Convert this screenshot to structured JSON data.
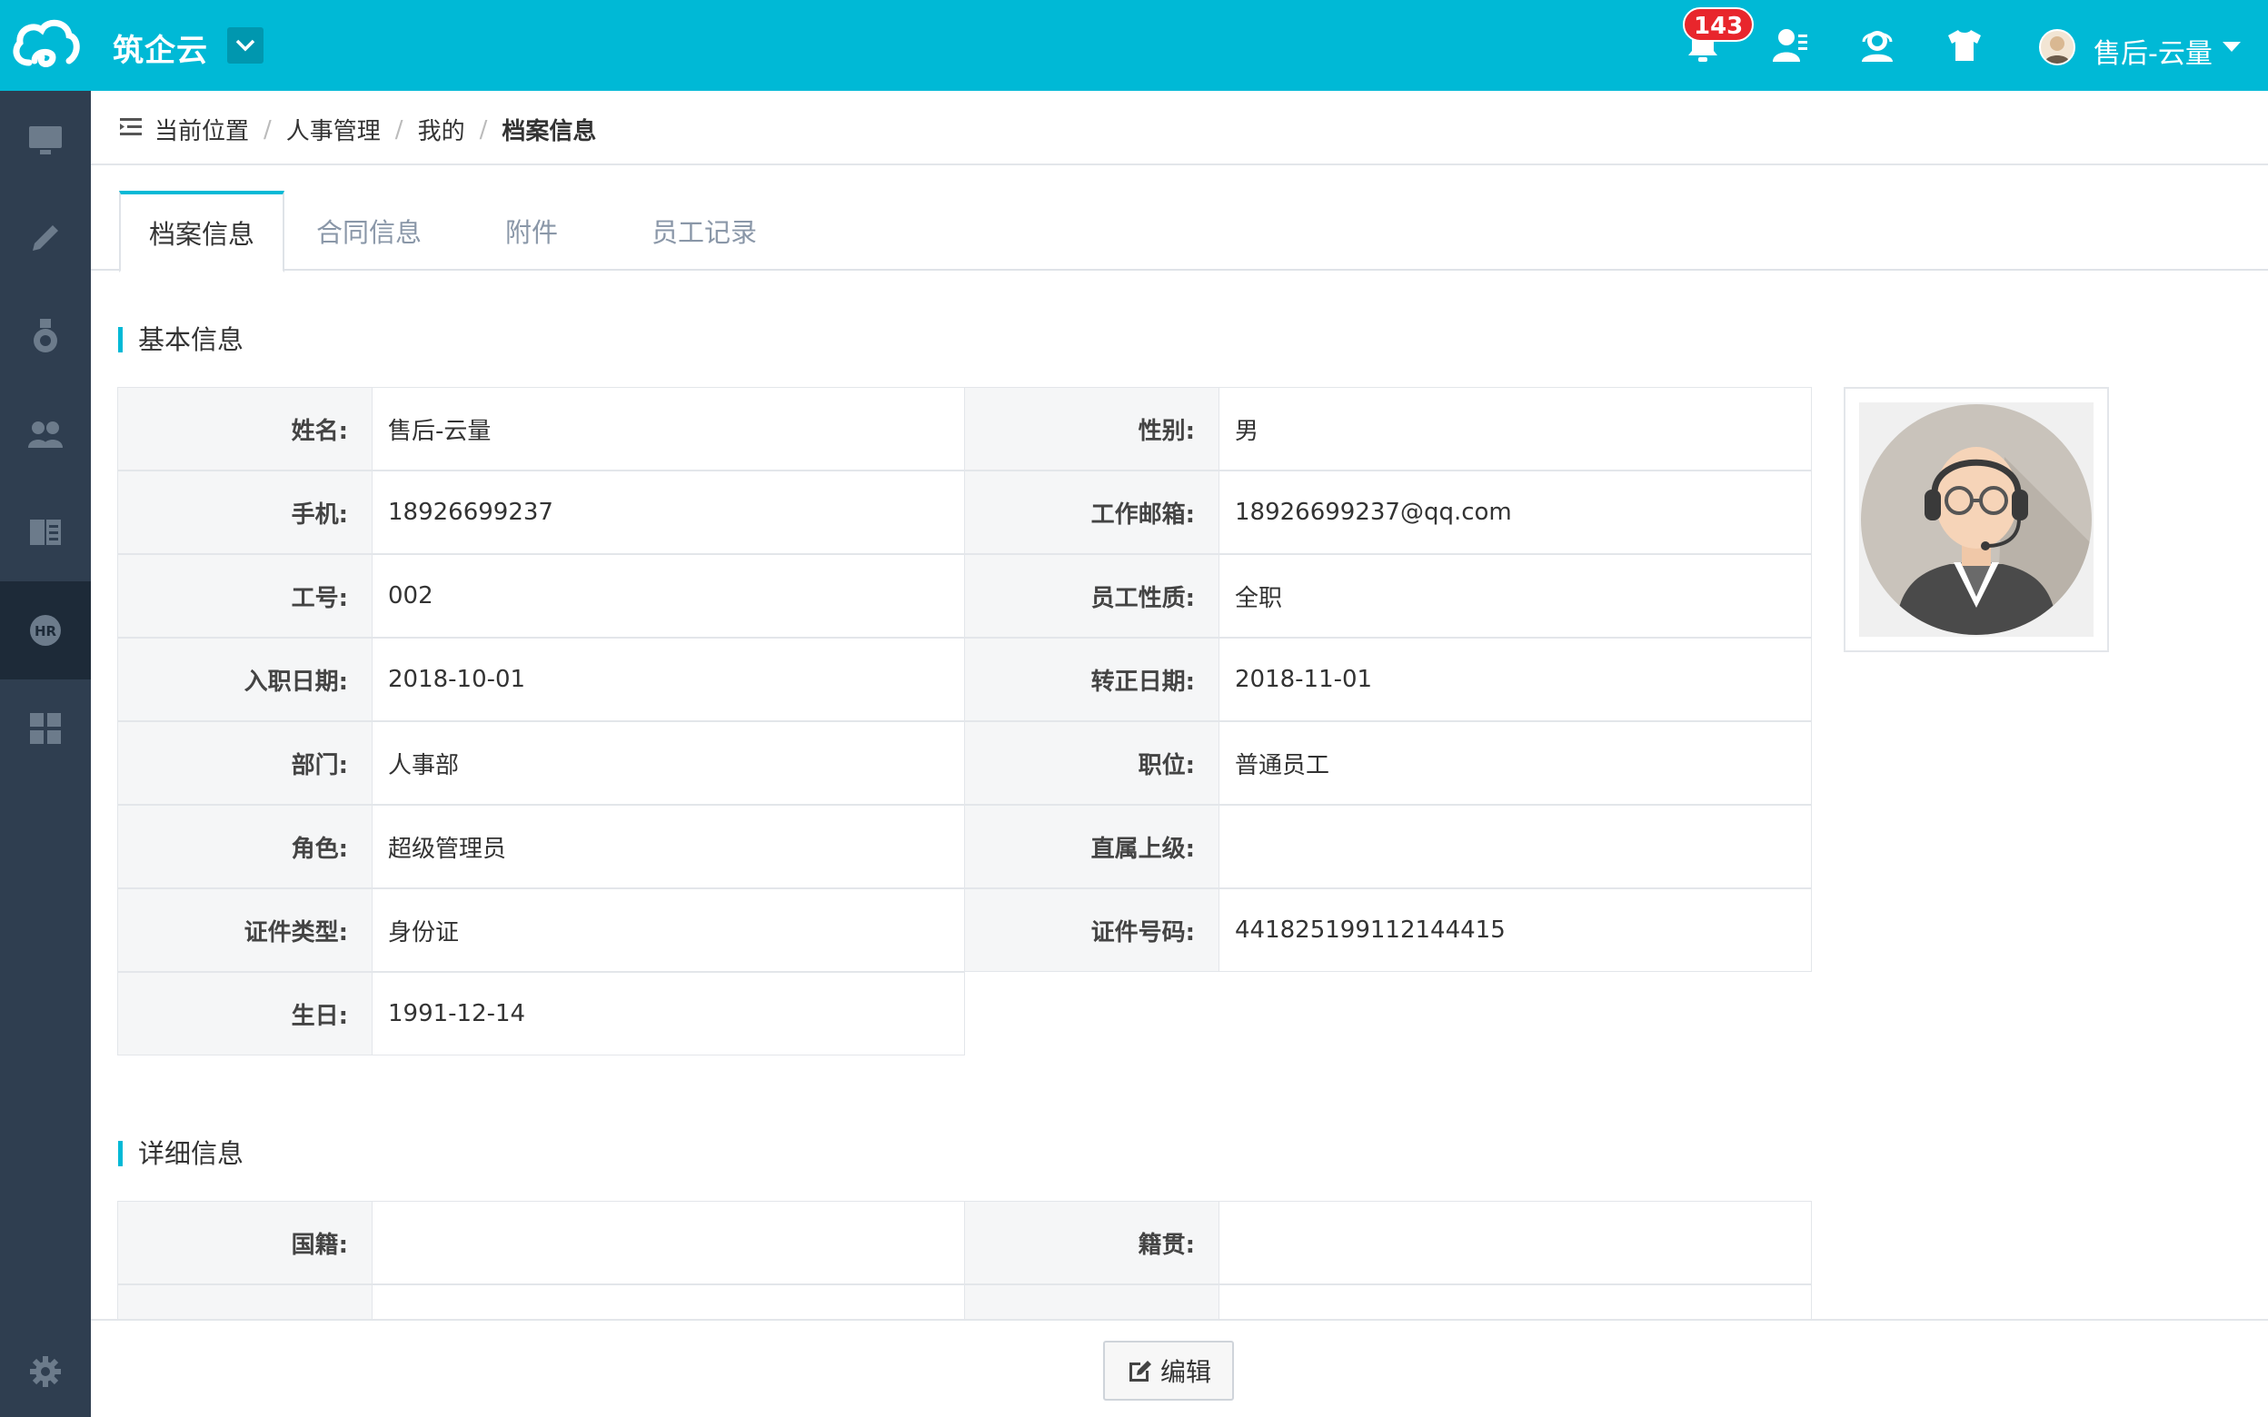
{
  "header": {
    "brand": "筑企云",
    "notification_count": "143",
    "user_name": "售后-云量",
    "icons": [
      "logo-icon",
      "bell-icon",
      "user-card-icon",
      "support-icon",
      "shirt-icon"
    ]
  },
  "sidebar": {
    "items": [
      {
        "icon": "monitor-icon"
      },
      {
        "icon": "pencil-icon"
      },
      {
        "icon": "medal-icon"
      },
      {
        "icon": "users-icon"
      },
      {
        "icon": "book-icon"
      },
      {
        "icon": "hr-icon",
        "label": "HR",
        "active": true
      },
      {
        "icon": "grid-icon"
      }
    ],
    "settings_icon": "gear-icon"
  },
  "breadcrumb": {
    "prefix": "当前位置",
    "items": [
      "人事管理",
      "我的"
    ],
    "current": "档案信息",
    "separator": "/"
  },
  "tabs": [
    {
      "label": "档案信息",
      "active": true
    },
    {
      "label": "合同信息"
    },
    {
      "label": "附件"
    },
    {
      "label": "员工记录"
    }
  ],
  "basic_info": {
    "title": "基本信息",
    "rows": [
      [
        {
          "label": "姓名:",
          "value": "售后-云量"
        },
        {
          "label": "性别:",
          "value": "男"
        }
      ],
      [
        {
          "label": "手机:",
          "value": "18926699237"
        },
        {
          "label": "工作邮箱:",
          "value": "18926699237@qq.com"
        }
      ],
      [
        {
          "label": "工号:",
          "value": "002"
        },
        {
          "label": "员工性质:",
          "value": "全职"
        }
      ],
      [
        {
          "label": "入职日期:",
          "value": "2018-10-01"
        },
        {
          "label": "转正日期:",
          "value": "2018-11-01"
        }
      ],
      [
        {
          "label": "部门:",
          "value": "人事部"
        },
        {
          "label": "职位:",
          "value": "普通员工"
        }
      ],
      [
        {
          "label": "角色:",
          "value": "超级管理员"
        },
        {
          "label": "直属上级:",
          "value": ""
        }
      ],
      [
        {
          "label": "证件类型:",
          "value": "身份证"
        },
        {
          "label": "证件号码:",
          "value": "441825199112144415"
        }
      ],
      [
        {
          "label": "生日:",
          "value": "1991-12-14"
        }
      ]
    ]
  },
  "detail_info": {
    "title": "详细信息",
    "rows": [
      [
        {
          "label": "国籍:",
          "value": ""
        },
        {
          "label": "籍贯:",
          "value": ""
        }
      ]
    ]
  },
  "actions": {
    "edit_label": "编辑"
  },
  "colors": {
    "primary": "#00b9d6",
    "sidebar": "#2f3e50",
    "sidebar_active": "#1d2a38",
    "badge": "#e8262c"
  }
}
